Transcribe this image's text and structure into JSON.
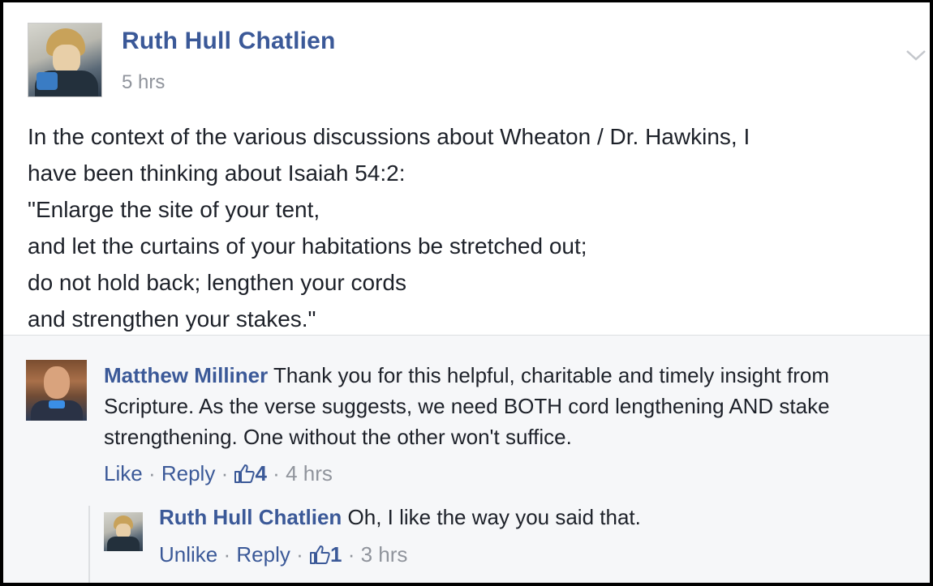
{
  "post": {
    "author": "Ruth Hull Chatlien",
    "timestamp": "5 hrs",
    "body_lines": [
      "In the context of the various discussions about Wheaton / Dr. Hawkins, I",
      "have been thinking about Isaiah 54:2:",
      "\"Enlarge the site of your tent,",
      "and let the curtains of your habitations be stretched out;",
      "do not hold back; lengthen your cords",
      "and strengthen your stakes.\""
    ],
    "menu_icon": "chevron-down-icon"
  },
  "comments": [
    {
      "author": "Matthew Milliner",
      "text_lines": [
        " Thank you for this helpful, charitable and timely insight from",
        "Scripture. As the verse suggests, we need BOTH cord lengthening AND stake",
        "strengthening. One without the other won't suffice."
      ],
      "like_label": "Like",
      "reply_label": "Reply",
      "like_count": "4",
      "timestamp": "4 hrs",
      "like_icon": "thumbs-up-icon",
      "replies": [
        {
          "author": "Ruth Hull Chatlien",
          "text": " Oh, I like the way you said that.",
          "like_label": "Unlike",
          "reply_label": "Reply",
          "like_count": "1",
          "timestamp": "3 hrs",
          "like_icon": "thumbs-up-icon"
        }
      ]
    }
  ],
  "colors": {
    "link": "#3b5998",
    "text": "#1d2129",
    "muted": "#90949c",
    "comment_bg": "#f6f7f9"
  }
}
